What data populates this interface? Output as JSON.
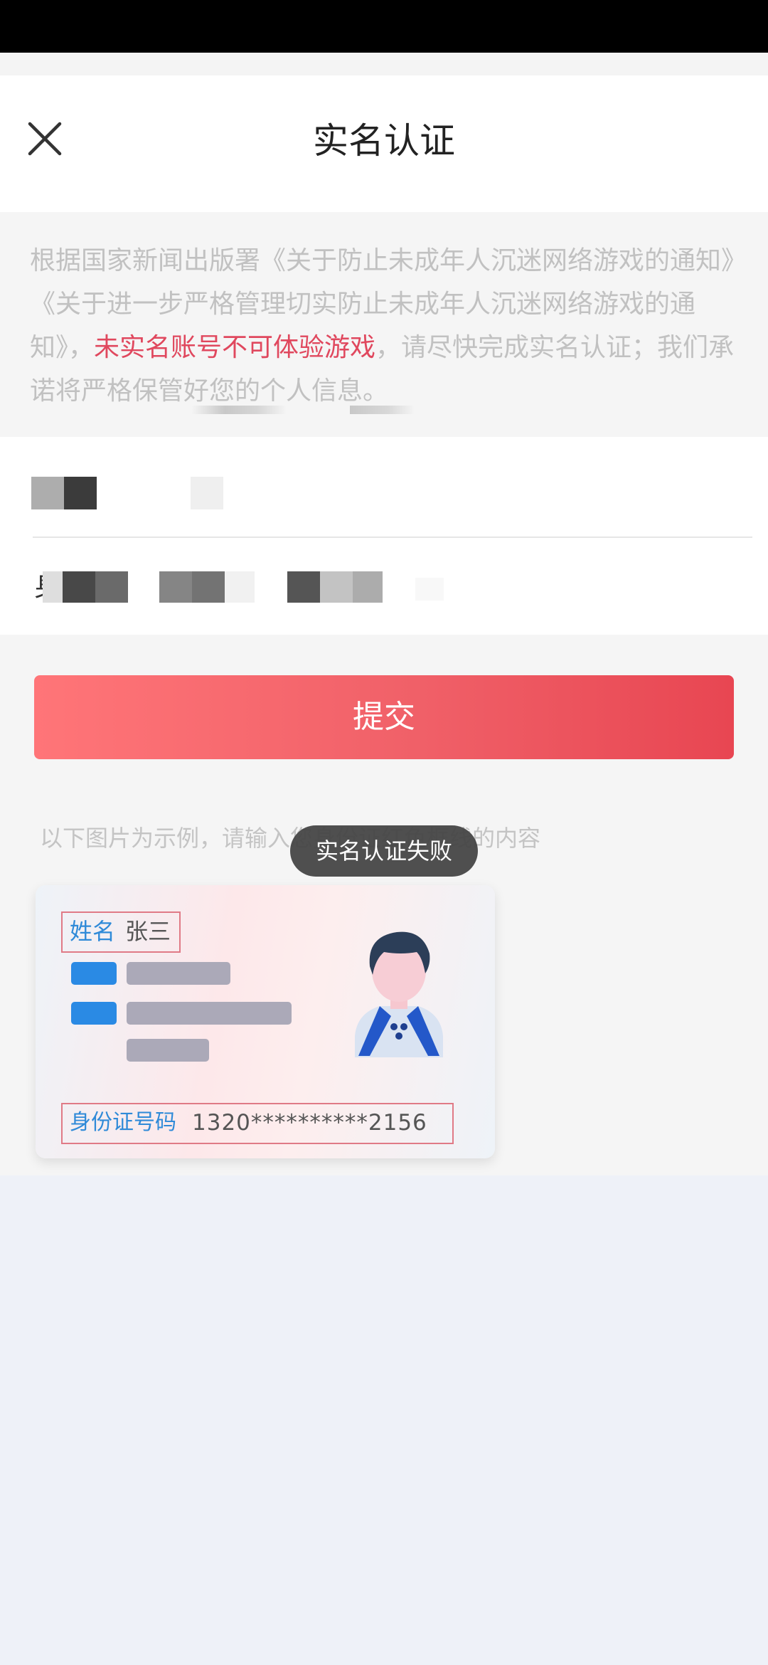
{
  "header": {
    "title": "实名认证",
    "close_icon": "close-icon"
  },
  "notice": {
    "text_before": "根据国家新闻出版署《关于防止未成年人沉迷网络游戏的通知》《关于进一步严格管理切实防止未成年人沉迷网络游戏的通知》，",
    "warning": "未实名账号不可体验游戏",
    "text_after": "，请尽快完成实名认证；我们承诺将严格保管好您的个人信息。",
    "warning_color": "#e0485e"
  },
  "form": {
    "id_label_partial": "身"
  },
  "submit": {
    "label": "提交"
  },
  "example": {
    "hint": "以下图片为示例，请输入您身份证红色框线的内容",
    "name_label": "姓名",
    "name_value": "张三",
    "idnum_label": "身份证号码",
    "idnum_value": "1320**********2156"
  },
  "toast": {
    "text": "实名认证失败"
  },
  "colors": {
    "accent": "#f06068",
    "label_blue": "#2f8ad8",
    "frame_red": "#e07a86"
  }
}
